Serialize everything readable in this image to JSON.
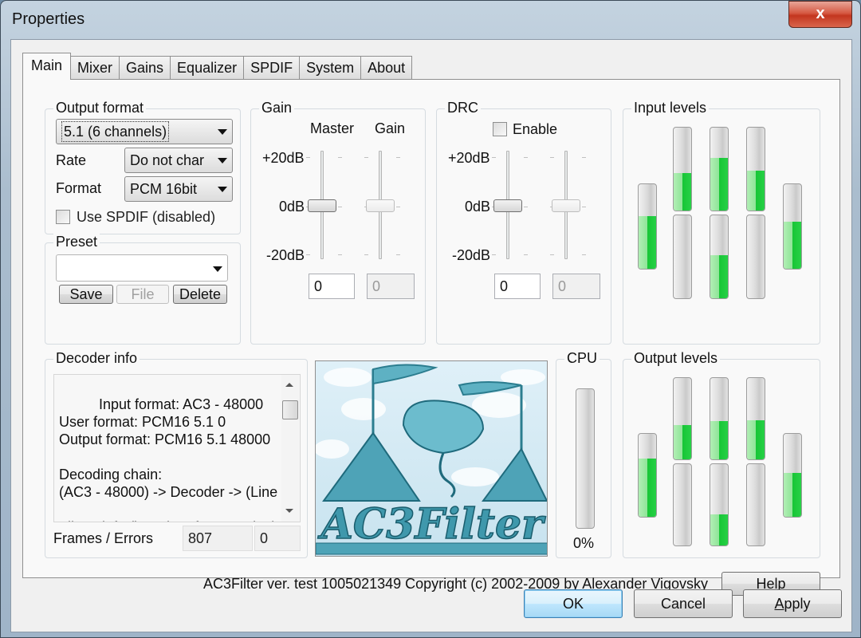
{
  "window": {
    "title": "Properties",
    "close_label": "x"
  },
  "tabs": [
    "Main",
    "Mixer",
    "Gains",
    "Equalizer",
    "SPDIF",
    "System",
    "About"
  ],
  "active_tab": "Main",
  "output_format": {
    "group_label": "Output format",
    "channels_value": "5.1 (6 channels)",
    "rate_label": "Rate",
    "rate_value": "Do not char",
    "format_label": "Format",
    "format_value": "PCM 16bit",
    "spdif_label": "Use SPDIF (disabled)",
    "spdif_checked": false
  },
  "preset": {
    "group_label": "Preset",
    "value": "",
    "save_label": "Save",
    "file_label": "File",
    "delete_label": "Delete"
  },
  "gain": {
    "group_label": "Gain",
    "master_label": "Master",
    "gain_label": "Gain",
    "scale": [
      "+20dB",
      "0dB",
      "-20dB"
    ],
    "range_db": [
      -20,
      20
    ],
    "master_db": 0,
    "gain_db": 0,
    "master_value": "0",
    "gain_value": "0"
  },
  "drc": {
    "group_label": "DRC",
    "enable_label": "Enable",
    "enabled": false,
    "scale": [
      "+20dB",
      "0dB",
      "-20dB"
    ],
    "range_db": [
      -20,
      20
    ],
    "slider1_db": 0,
    "slider2_db": 0,
    "value1": "0",
    "value2": "0"
  },
  "input_levels": {
    "group_label": "Input levels",
    "left": 0.62,
    "front_top": [
      0.45,
      0.63,
      0.48
    ],
    "front_bottom": [
      0.0,
      0.52,
      0.0
    ],
    "right": 0.56
  },
  "output_levels": {
    "group_label": "Output levels",
    "left": 0.7,
    "front_top": [
      0.42,
      0.47,
      0.48
    ],
    "front_bottom": [
      0.0,
      0.38,
      0.0
    ],
    "right": 0.53
  },
  "decoder_info": {
    "group_label": "Decoder info",
    "text": "Input format: AC3 - 48000\nUser format: PCM16 5.1 0\nOutput format: PCM16 5.1 48000\n\nDecoding chain:\n(AC3 - 48000) -> Decoder -> (Line\n\nFilters info (in order of processing):",
    "frames_label": "Frames / Errors",
    "frames": "807",
    "errors": "0"
  },
  "logo": {
    "text": "AC3Filter"
  },
  "cpu": {
    "group_label": "CPU",
    "value": "0%",
    "level": 0.0
  },
  "footer": {
    "copyright": "AC3Filter ver. test 1005021349 Copyright (c) 2002-2009 by Alexander Vigovsky",
    "help_label": "Help"
  },
  "dialog_buttons": {
    "ok": "OK",
    "cancel": "Cancel",
    "apply": "Apply"
  }
}
